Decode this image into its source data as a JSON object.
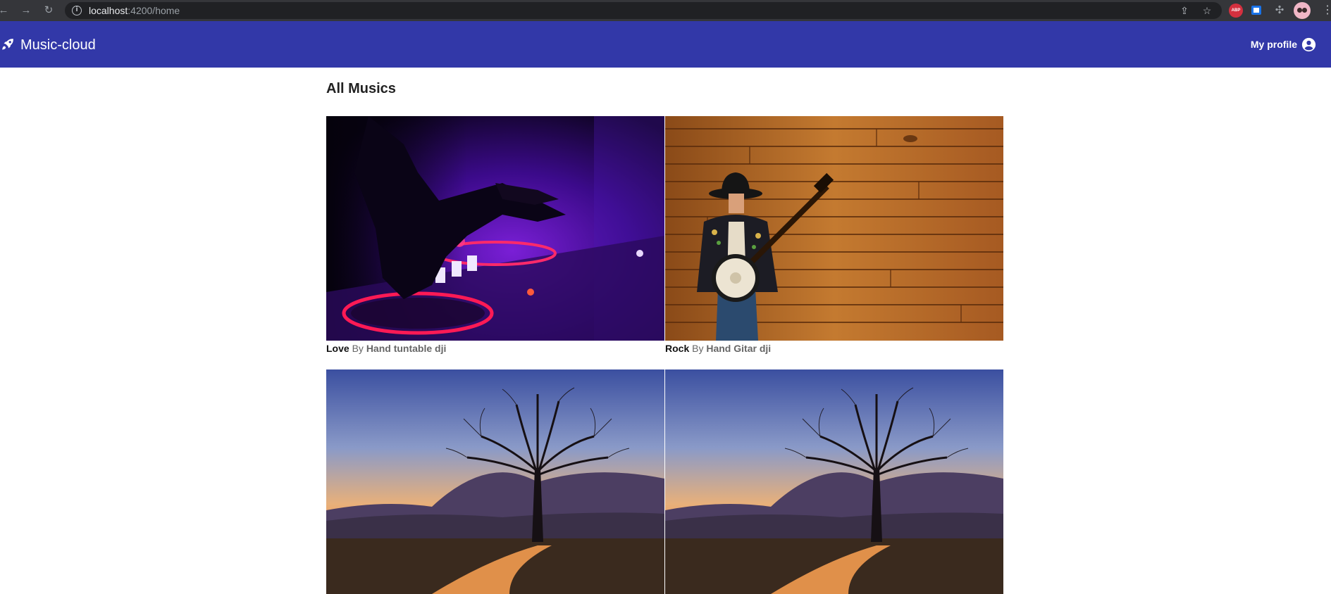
{
  "browser": {
    "url_host": "localhost",
    "url_path": ":4200/home"
  },
  "header": {
    "app_title": "Music-cloud",
    "profile_label": "My profile"
  },
  "main": {
    "title": "All Musics",
    "cards": [
      {
        "song": "Love",
        "by": "By",
        "artist": "Hand tuntable dji",
        "image": "dj-turntable"
      },
      {
        "song": "Rock",
        "by": "By",
        "artist": "Hand Gitar dji",
        "image": "banjo-player"
      },
      {
        "song": "",
        "by": "",
        "artist": "",
        "image": "tree-sunset"
      },
      {
        "song": "",
        "by": "",
        "artist": "",
        "image": "tree-sunset"
      }
    ]
  },
  "icons": {
    "logo": "rocket-icon",
    "profile": "account-circle-icon"
  },
  "colors": {
    "toolbar": "#3238a8",
    "browser_bar": "#35363a"
  }
}
